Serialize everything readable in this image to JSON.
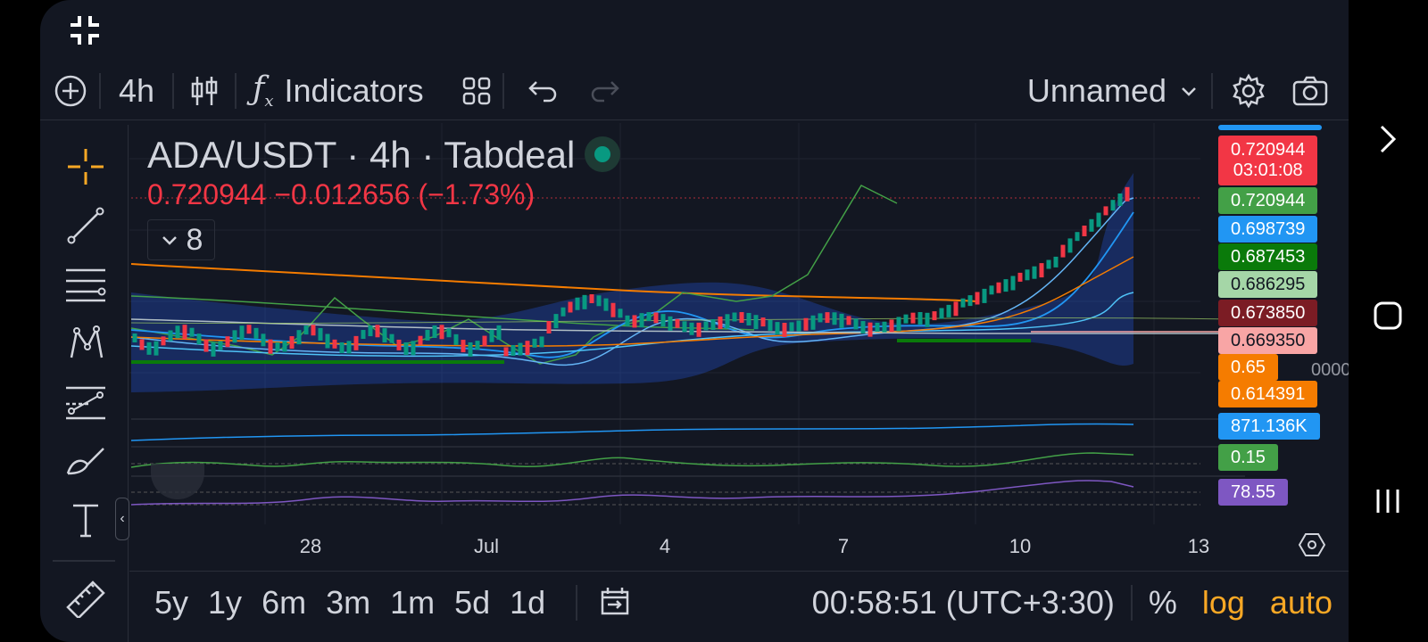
{
  "toolbar": {
    "interval": "4h",
    "indicators_label": "Indicators",
    "layout_name": "Unnamed"
  },
  "legend": {
    "symbol": "ADA/USDT",
    "interval": "4h",
    "exchange": "Tabdeal",
    "last_price": "0.720944",
    "change": "−0.012656",
    "change_pct": "(−1.73%)",
    "indicator_count": "8"
  },
  "price_scale": {
    "tags": [
      {
        "text": "0.720944",
        "sub": "03:01:08",
        "color": "#f23645"
      },
      {
        "text": "0.720944",
        "color": "#43a047"
      },
      {
        "text": "0.698739",
        "color": "#2196f3"
      },
      {
        "text": "0.687453",
        "color": "#0a7a0a"
      },
      {
        "text": "0.686295",
        "color": "#a5d6a7"
      },
      {
        "text": "0.673850",
        "color": "#7b1c24"
      },
      {
        "text": "0.669350",
        "color": "#f8a5a5"
      },
      {
        "text": "0.65",
        "color": "#f57c00"
      },
      {
        "text": "0000",
        "color": "transparent"
      },
      {
        "text": "0.614391",
        "color": "#f57c00"
      },
      {
        "text": "871.136K",
        "color": "#2196f3"
      },
      {
        "text": "0.15",
        "color": "#43a047"
      },
      {
        "text": "78.55",
        "color": "#7e57c2"
      }
    ]
  },
  "time_axis": {
    "labels": [
      "28",
      "Jul",
      "4",
      "7",
      "10",
      "13"
    ]
  },
  "bottom_bar": {
    "ranges": [
      "5y",
      "1y",
      "6m",
      "3m",
      "1m",
      "5d",
      "1d"
    ],
    "clock": "00:58:51 (UTC+3:30)",
    "percent": "%",
    "log": "log",
    "auto": "auto"
  },
  "colors": {
    "background": "#131722",
    "up": "#089981",
    "down": "#f23645",
    "accent": "#f9a825"
  },
  "chart_data": {
    "type": "candlestick",
    "symbol": "ADA/USDT",
    "interval": "4h",
    "x_labels": [
      "28",
      "Jul",
      "4",
      "7",
      "10",
      "13"
    ],
    "price_range": [
      0.58,
      0.74
    ],
    "last": 0.720944
  }
}
